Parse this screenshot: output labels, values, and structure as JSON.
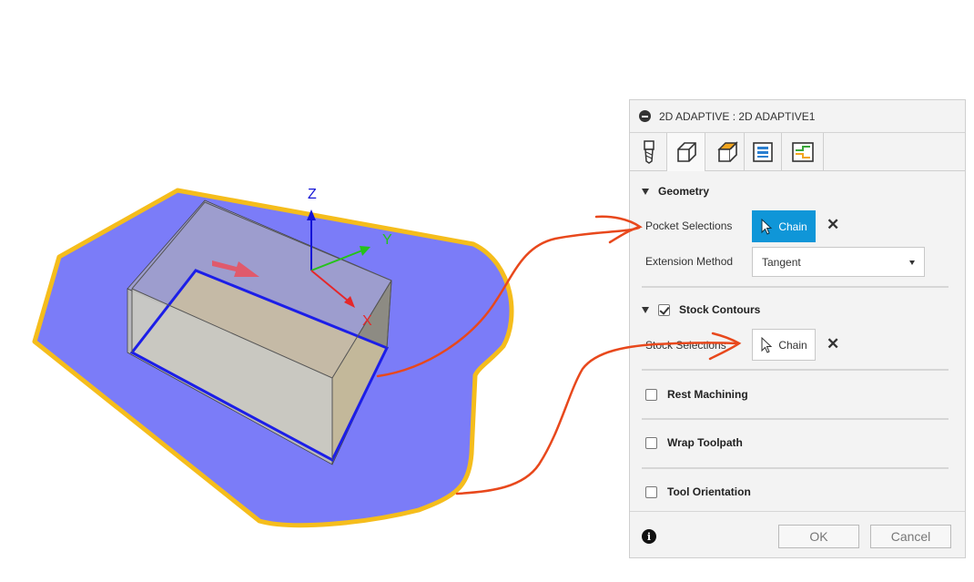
{
  "viewport": {
    "axes": {
      "z_label": "Z",
      "y_label": "Y",
      "x_label": "X"
    },
    "colors": {
      "boundary_fill": "#7b7cf8",
      "boundary_stroke": "#f5bd1c",
      "pocket_edge": "#1c1ee8",
      "axis_z": "#1414d6",
      "axis_y": "#25c21a",
      "axis_x": "#e5272a"
    }
  },
  "panel": {
    "title": "2D ADAPTIVE : 2D ADAPTIVE1",
    "tabs": [
      {
        "icon": "tool-icon"
      },
      {
        "icon": "geometry-icon",
        "active": true
      },
      {
        "icon": "heights-icon"
      },
      {
        "icon": "passes-icon"
      },
      {
        "icon": "linking-icon"
      }
    ],
    "geometry": {
      "title": "Geometry",
      "pocket_selections_label": "Pocket Selections",
      "pocket_chain_label": "Chain",
      "extension_method_label": "Extension Method",
      "extension_method_value": "Tangent"
    },
    "stock_contours": {
      "title": "Stock Contours",
      "checked": true,
      "stock_selections_label": "Stock Selections",
      "stock_chain_label": "Chain"
    },
    "rest_machining": {
      "title": "Rest Machining",
      "checked": false
    },
    "wrap_toolpath": {
      "title": "Wrap Toolpath",
      "checked": false
    },
    "tool_orientation": {
      "title": "Tool Orientation",
      "checked": false
    },
    "footer": {
      "ok_label": "OK",
      "cancel_label": "Cancel"
    },
    "colors": {
      "primary_button": "#0f96d8"
    }
  },
  "annotation_color": "#e8481c"
}
